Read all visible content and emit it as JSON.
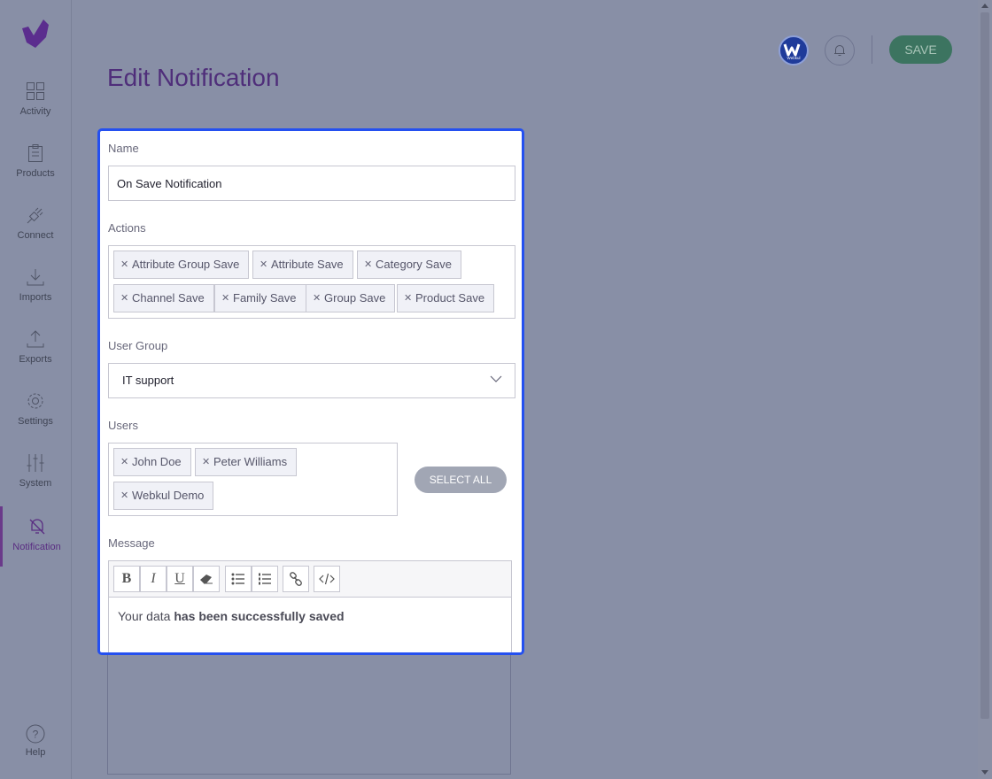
{
  "colors": {
    "accent": "#4f2e7a",
    "highlight": "#2450f0",
    "save": "#3c7460"
  },
  "sidebar": {
    "items": [
      {
        "label": "Activity",
        "icon": "dashboard-icon"
      },
      {
        "label": "Products",
        "icon": "clipboard-icon"
      },
      {
        "label": "Connect",
        "icon": "plug-icon"
      },
      {
        "label": "Imports",
        "icon": "download-icon"
      },
      {
        "label": "Exports",
        "icon": "upload-icon"
      },
      {
        "label": "Settings",
        "icon": "gear-icon"
      },
      {
        "label": "System",
        "icon": "sliders-icon"
      },
      {
        "label": "Notification",
        "icon": "notification-icon"
      }
    ],
    "help_label": "Help"
  },
  "header": {
    "title": "Edit Notification",
    "avatar_text": "Webkul",
    "save_label": "SAVE"
  },
  "form": {
    "name": {
      "label": "Name",
      "value": "On Save Notification"
    },
    "actions": {
      "label": "Actions",
      "tags": [
        "Attribute Group Save",
        "Attribute Save",
        "Category Save",
        "Channel Save",
        "Family Save",
        "Group Save",
        "Product Save"
      ]
    },
    "user_group": {
      "label": "User Group",
      "value": "IT support"
    },
    "users": {
      "label": "Users",
      "tags": [
        "John Doe",
        "Peter Williams",
        "Webkul Demo"
      ],
      "select_all_label": "SELECT ALL"
    },
    "message": {
      "label": "Message",
      "text_plain": "Your data ",
      "text_bold": "has been successfully saved"
    }
  }
}
